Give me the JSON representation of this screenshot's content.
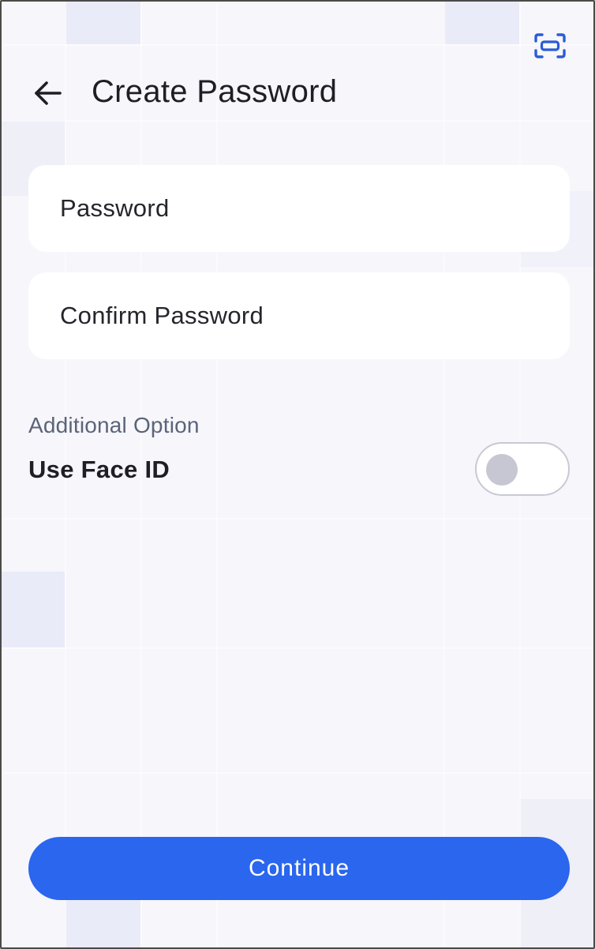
{
  "header": {
    "title": "Create Password",
    "back_icon": "arrow-left-icon",
    "scan_icon": "face-scan-icon"
  },
  "form": {
    "password_placeholder": "Password",
    "confirm_placeholder": "Confirm Password"
  },
  "options": {
    "section_label": "Additional Option",
    "face_id_label": "Use Face ID",
    "face_id_enabled": false
  },
  "actions": {
    "continue_label": "Continue"
  },
  "colors": {
    "accent": "#2a66ee",
    "background": "#f6f6fb",
    "field_bg": "#ffffff",
    "text_primary": "#1e1e24",
    "text_secondary": "#5a6478"
  }
}
